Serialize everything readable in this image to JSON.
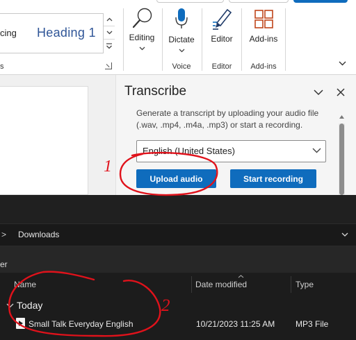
{
  "ribbon": {
    "styles": {
      "partial_left": "cing",
      "heading1": "Heading 1",
      "group_partial": "s"
    },
    "editing": {
      "label": "Editing"
    },
    "dictate": {
      "label": "Dictate",
      "group": "Voice"
    },
    "editor": {
      "label": "Editor",
      "group": "Editor"
    },
    "addins": {
      "label": "Add-ins",
      "group": "Add-ins"
    }
  },
  "transcribe": {
    "title": "Transcribe",
    "description": "Generate a transcript by uploading your audio file (.wav, .mp4, .m4a, .mp3) or start a recording.",
    "language": "English (United States)",
    "upload_button": "Upload audio",
    "record_button": "Start recording"
  },
  "explorer": {
    "breadcrumb_sep": ">",
    "folder": "Downloads",
    "toolbar_partial": "er",
    "columns": {
      "name": "Name",
      "date": "Date modified",
      "type": "Type"
    },
    "group": "Today",
    "file": {
      "name": "Small Talk  Everyday English",
      "date": "10/21/2023 11:25 AM",
      "type": "MP3 File"
    }
  },
  "annotations": {
    "mark1": "1",
    "mark2": "2"
  },
  "colors": {
    "accent": "#0f6cbd",
    "annotation": "#e0121b",
    "explorer_bg": "#1c1c1c",
    "heading_blue": "#2f5597"
  }
}
